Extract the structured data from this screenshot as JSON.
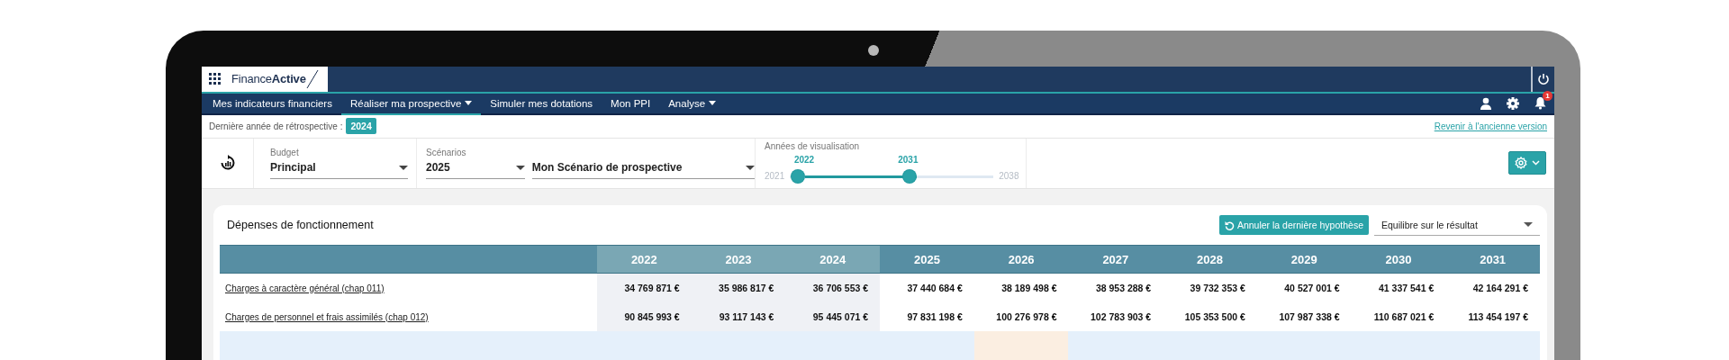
{
  "app": {
    "logo": "Finance**Active**"
  },
  "nav": {
    "items": [
      {
        "label": "Mes indicateurs financiers",
        "selected": false,
        "has_menu": false
      },
      {
        "label": "Réaliser ma prospective",
        "selected": true,
        "has_menu": true
      },
      {
        "label": "Simuler mes dotations",
        "selected": false,
        "has_menu": false
      },
      {
        "label": "Mon PPI",
        "selected": false,
        "has_menu": false
      },
      {
        "label": "Analyse",
        "selected": false,
        "has_menu": true
      }
    ],
    "notifications": {
      "count": "1"
    }
  },
  "retrospective": {
    "label": "Dernière année de rétrospective :",
    "year": "2024",
    "link": "Revenir à l'ancienne version"
  },
  "filters": {
    "budget": {
      "label": "Budget",
      "value": "Principal"
    },
    "scenarios": {
      "label": "Scénarios",
      "year": "2025",
      "name": "Mon Scénario de prospective"
    },
    "years": {
      "label": "Années de visualisation",
      "min": "2021",
      "max": "2038",
      "thumbs": [
        {
          "label": "2022",
          "level": 0.07
        },
        {
          "label": "2031",
          "level": 0.58
        }
      ]
    }
  },
  "card": {
    "title": "Dépenses de fonctionnement",
    "undo_button": "Annuler la dernière hypothèse",
    "balance_select": "Equilibre sur le résultat",
    "table": {
      "columns": [
        {
          "label": "2022",
          "kind": "retrospective"
        },
        {
          "label": "2023",
          "kind": "retrospective"
        },
        {
          "label": "2024",
          "kind": "retrospective"
        },
        {
          "label": "2025",
          "kind": "prospective"
        },
        {
          "label": "2026",
          "kind": "prospective"
        },
        {
          "label": "2027",
          "kind": "prospective"
        },
        {
          "label": "2028",
          "kind": "prospective"
        },
        {
          "label": "2029",
          "kind": "prospective"
        },
        {
          "label": "2030",
          "kind": "prospective"
        },
        {
          "label": "2031",
          "kind": "prospective"
        }
      ],
      "rows": [
        {
          "kind": "link",
          "label": "Charges à caractère général (chap 011)",
          "values": [
            "34 769 871 €",
            "35 986 817 €",
            "36 706 553 €",
            "37 440 684 €",
            "38 189 498 €",
            "38 953 288 €",
            "39 732 353 €",
            "40 527 001 €",
            "41 337 541 €",
            "42 164 291 €"
          ]
        },
        {
          "kind": "link",
          "label": "Charges de personnel et frais assimilés (chap 012)",
          "values": [
            "90 845 993 €",
            "93 117 143 €",
            "95 445 071 €",
            "97 831 198 €",
            "100 276 978 €",
            "102 783 903 €",
            "105 353 500 €",
            "107 987 338 €",
            "110 687 021 €",
            "113 454 197 €"
          ]
        },
        {
          "kind": "partial",
          "cells": [
            {
              "highlighted": false
            },
            {
              "highlighted": false
            },
            {
              "highlighted": false
            },
            {
              "highlighted": false
            },
            {
              "highlighted": true
            },
            {
              "highlighted": false
            },
            {
              "highlighted": false
            },
            {
              "highlighted": false
            },
            {
              "highlighted": false
            },
            {
              "highlighted": false
            }
          ]
        }
      ]
    }
  }
}
